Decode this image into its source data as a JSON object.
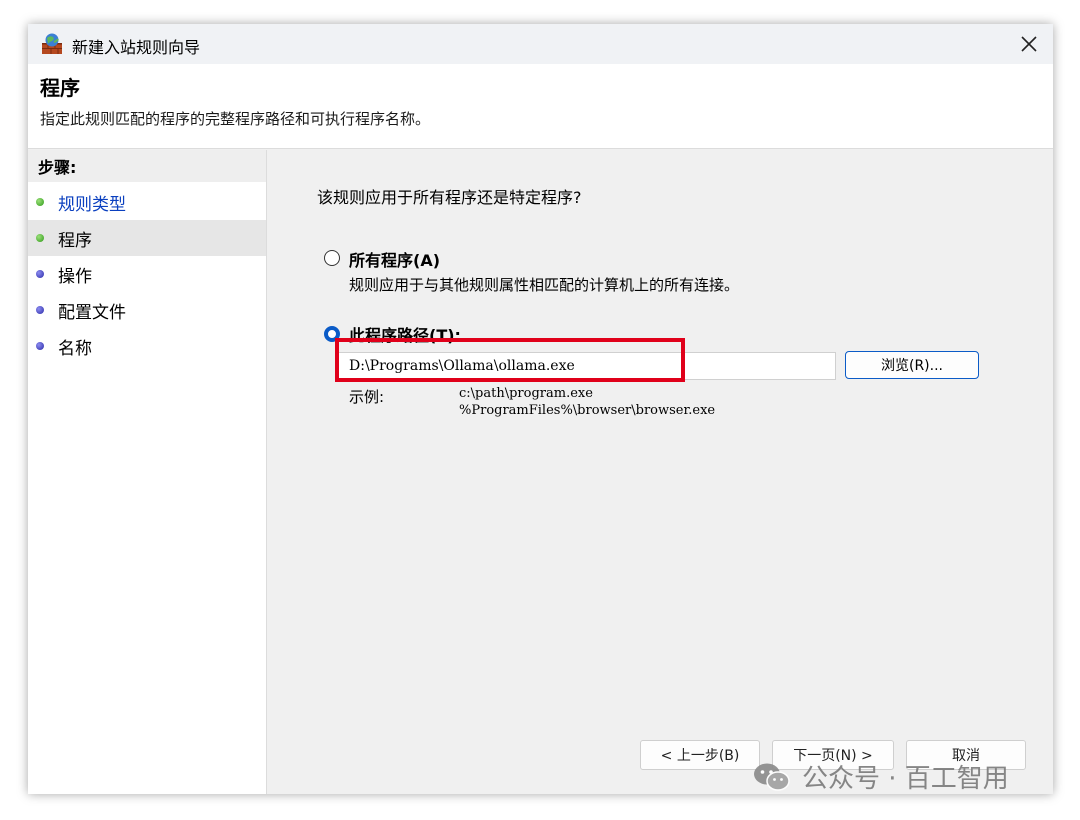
{
  "window": {
    "title": "新建入站规则向导",
    "close_glyph": "✕",
    "title_icon": "firewall-icon"
  },
  "header": {
    "title": "程序",
    "description": "指定此规则匹配的程序的完整程序路径和可执行程序名称。"
  },
  "steps": {
    "heading": "步骤:",
    "items": [
      {
        "label": "规则类型",
        "state": "completed"
      },
      {
        "label": "程序",
        "state": "current"
      },
      {
        "label": "操作",
        "state": "pending"
      },
      {
        "label": "配置文件",
        "state": "pending"
      },
      {
        "label": "名称",
        "state": "pending"
      }
    ]
  },
  "content": {
    "question": "该规则应用于所有程序还是特定程序?",
    "all_programs": {
      "label": "所有程序(A)",
      "description": "规则应用于与其他规则属性相匹配的计算机上的所有连接。",
      "selected": false
    },
    "this_program": {
      "label": "此程序路径(T):",
      "selected": true,
      "path_value": "D:\\Programs\\Ollama\\ollama.exe",
      "browse_label": "浏览(R)..."
    },
    "example": {
      "label": "示例:",
      "lines": [
        "c:\\path\\program.exe",
        "%ProgramFiles%\\browser\\browser.exe"
      ]
    }
  },
  "footer": {
    "back_label": "< 上一步(B)",
    "next_label": "下一页(N) >",
    "cancel_label": "取消"
  },
  "watermark": {
    "text": "公众号 · 百工智用",
    "icon": "wechat-icon"
  },
  "colors": {
    "accent": "#0b5bc7",
    "highlight": "#e0001a",
    "link": "#0a3fbf"
  }
}
